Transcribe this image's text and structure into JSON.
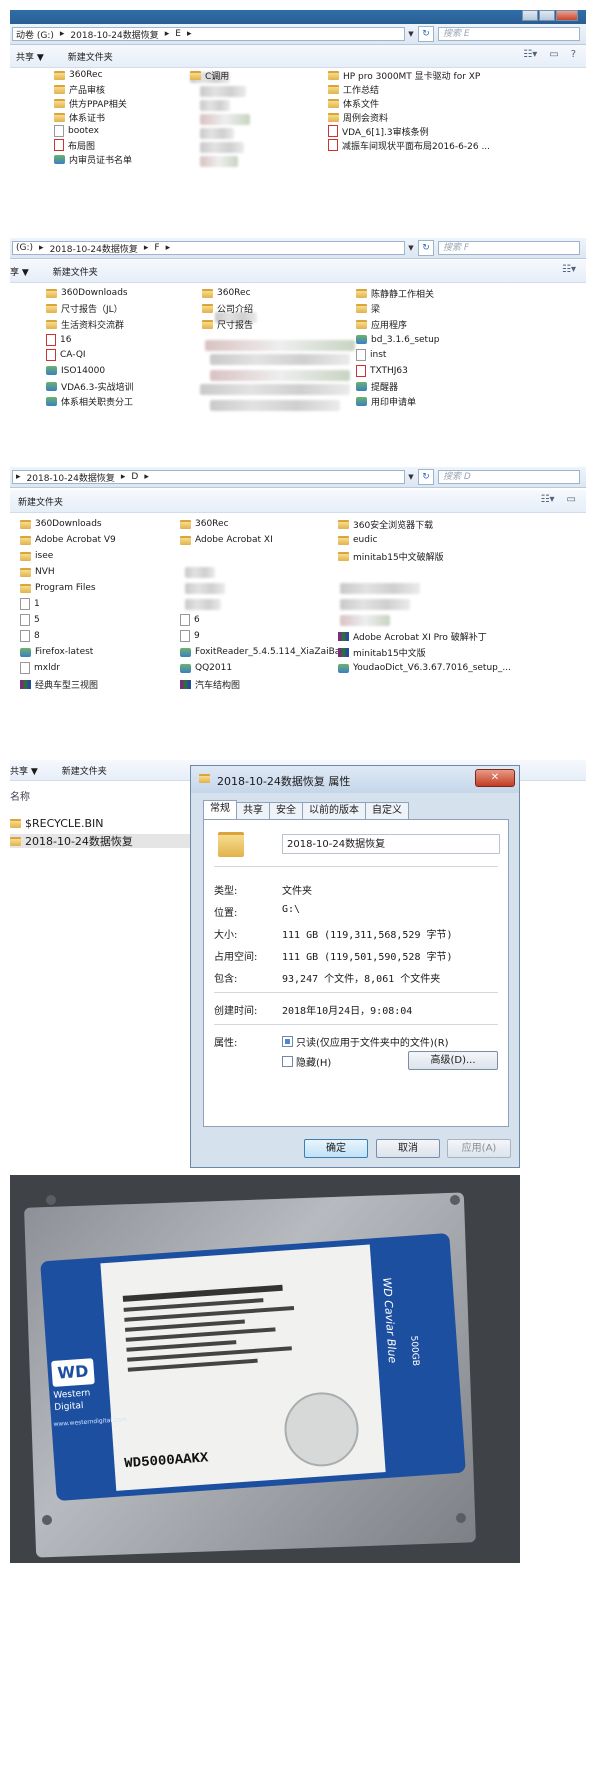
{
  "e_window": {
    "path": [
      "动卷 (G:)",
      "2018-10-24数据恢复",
      "E"
    ],
    "search_placeholder": "搜索 E",
    "toolbar": {
      "share_label": "共享 ▼",
      "new_folder_label": "新建文件夹"
    },
    "col1": [
      {
        "name": "360Rec",
        "type": "folder"
      },
      {
        "name": "产品审核",
        "type": "folder"
      },
      {
        "name": "供方PPAP相关",
        "type": "folder"
      },
      {
        "name": "体系证书",
        "type": "folder"
      },
      {
        "name": "bootex",
        "type": "doc"
      },
      {
        "name": "布局图",
        "type": "pdf"
      },
      {
        "name": "内审员证书名单",
        "type": "exe"
      }
    ],
    "col2_visible": [
      {
        "name": "C调用",
        "type": "folder"
      }
    ],
    "col3": [
      {
        "name": "HP pro 3000MT 显卡驱动 for XP",
        "type": "folder"
      },
      {
        "name": "工作总结",
        "type": "folder"
      },
      {
        "name": "体系文件",
        "type": "folder"
      },
      {
        "name": "周例会资料",
        "type": "folder"
      },
      {
        "name": "VDA_6[1].3审核条例",
        "type": "pdf"
      },
      {
        "name": "减振车间现状平面布局2016-6-26 ...",
        "type": "pdf"
      }
    ]
  },
  "f_window": {
    "path": [
      "(G:)",
      "2018-10-24数据恢复",
      "F"
    ],
    "search_placeholder": "搜索 F",
    "toolbar": {
      "share_label": "享 ▼",
      "new_folder_label": "新建文件夹"
    },
    "col1": [
      {
        "name": "360Downloads",
        "type": "folder"
      },
      {
        "name": "尺寸报告（JL）",
        "type": "folder"
      },
      {
        "name": "生活资料交流群",
        "type": "folder"
      },
      {
        "name": "16",
        "type": "pdf"
      },
      {
        "name": "CA-QI",
        "type": "pdf"
      },
      {
        "name": "ISO14000",
        "type": "exe"
      },
      {
        "name": "VDA6.3-实战培训",
        "type": "exe"
      },
      {
        "name": "体系相关职责分工",
        "type": "exe"
      }
    ],
    "col2": [
      {
        "name": "360Rec",
        "type": "folder"
      },
      {
        "name": "公司介绍",
        "type": "folder"
      },
      {
        "name": "尺寸报告",
        "type": "folder"
      }
    ],
    "col3": [
      {
        "name": "陈静静工作相关",
        "type": "folder"
      },
      {
        "name": "梁",
        "type": "folder"
      },
      {
        "name": "应用程序",
        "type": "folder"
      },
      {
        "name": "bd_3.1.6_setup",
        "type": "exe"
      },
      {
        "name": "inst",
        "type": "doc"
      },
      {
        "name": "TXTHJ63",
        "type": "pdf"
      },
      {
        "name": "提醒器",
        "type": "exe"
      },
      {
        "name": "用印申请单",
        "type": "exe"
      }
    ]
  },
  "d_window": {
    "path": [
      "2018-10-24数据恢复",
      "D"
    ],
    "search_placeholder": "搜索 D",
    "toolbar": {
      "new_folder_label": "新建文件夹"
    },
    "col1": [
      {
        "name": "360Downloads",
        "type": "folder"
      },
      {
        "name": "Adobe Acrobat V9",
        "type": "folder"
      },
      {
        "name": "isee",
        "type": "folder"
      },
      {
        "name": "NVH",
        "type": "folder"
      },
      {
        "name": "Program Files",
        "type": "folder"
      },
      {
        "name": "1",
        "type": "doc"
      },
      {
        "name": "5",
        "type": "doc"
      },
      {
        "name": "8",
        "type": "doc"
      },
      {
        "name": "Firefox-latest",
        "type": "exe"
      },
      {
        "name": "mxldr",
        "type": "doc"
      },
      {
        "name": "经典车型三视图",
        "type": "rar"
      }
    ],
    "col2": [
      {
        "name": "360Rec",
        "type": "folder"
      },
      {
        "name": "Adobe Acrobat XI",
        "type": "folder"
      },
      {
        "name": "6",
        "type": "doc"
      },
      {
        "name": "9",
        "type": "doc"
      },
      {
        "name": "FoxitReader_5.4.5.114_XiaZaiBa",
        "type": "exe"
      },
      {
        "name": "QQ2011",
        "type": "exe"
      },
      {
        "name": "汽车结构图",
        "type": "rar"
      }
    ],
    "col3": [
      {
        "name": "360安全浏览器下载",
        "type": "folder"
      },
      {
        "name": "eudic",
        "type": "folder"
      },
      {
        "name": "minitab15中文破解版",
        "type": "folder"
      },
      {
        "name": "Adobe Acrobat XI Pro 破解补丁",
        "type": "rar"
      },
      {
        "name": "minitab15中文版",
        "type": "rar"
      },
      {
        "name": "YoudaoDict_V6.3.67.7016_setup_...",
        "type": "exe"
      }
    ]
  },
  "g_window": {
    "toolbar": {
      "share_label": "共享 ▼",
      "new_folder_label": "新建文件夹"
    },
    "column_header": "名称",
    "items": [
      "$RECYCLE.BIN",
      "2018-10-24数据恢复"
    ]
  },
  "properties": {
    "title": "2018-10-24数据恢复 属性",
    "tabs": [
      "常规",
      "共享",
      "安全",
      "以前的版本",
      "自定义"
    ],
    "folder_name": "2018-10-24数据恢复",
    "type_label": "类型:",
    "type_value": "文件夹",
    "location_label": "位置:",
    "location_value": "G:\\",
    "size_label": "大小:",
    "size_value": "111 GB (119,311,568,529 字节)",
    "disk_size_label": "占用空间:",
    "disk_size_value": "111 GB (119,501,590,528 字节)",
    "contains_label": "包含:",
    "contains_value": "93,247 个文件，8,061 个文件夹",
    "created_label": "创建时间:",
    "created_value": "2018年10月24日，9:08:04",
    "attributes_label": "属性:",
    "readonly_label": "只读(仅应用于文件夹中的文件)(R)",
    "hidden_label": "隐藏(H)",
    "advanced_label": "高级(D)...",
    "ok_label": "确定",
    "cancel_label": "取消",
    "apply_label": "应用(A)"
  },
  "hdd_label": {
    "brand_line1": "Western",
    "brand_line2": "Digital",
    "logo": "WD",
    "url": "www.westerndigital.com",
    "model": "WD5000AAKX",
    "series": "WD Caviar Blue",
    "capacity": "500GB"
  }
}
